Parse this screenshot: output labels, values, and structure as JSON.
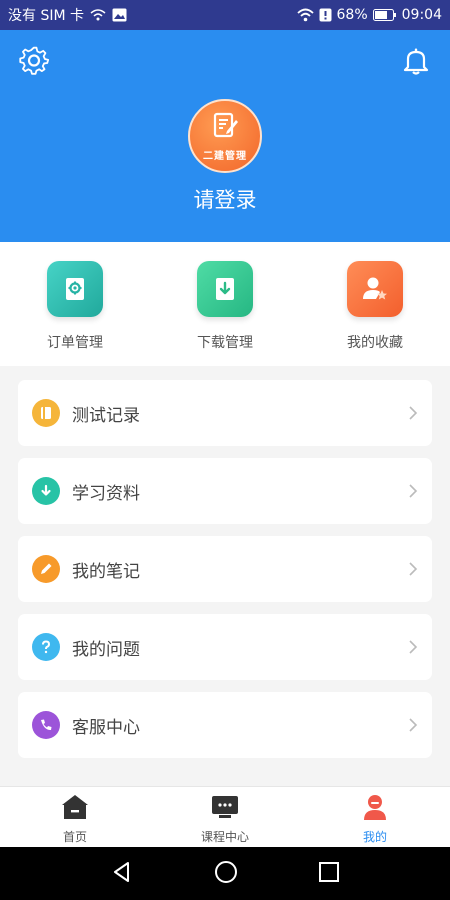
{
  "status_bar": {
    "carrier": "没有 SIM 卡",
    "battery": "68%",
    "time": "09:04"
  },
  "header": {
    "avatar_logo_text": "二建管理",
    "login_text": "请登录",
    "bg_color": "#2a8df0"
  },
  "quick_actions": [
    {
      "label": "订单管理",
      "icon": "order-icon"
    },
    {
      "label": "下载管理",
      "icon": "download-icon"
    },
    {
      "label": "我的收藏",
      "icon": "favorite-user-icon"
    }
  ],
  "menu": [
    {
      "label": "测试记录",
      "icon": "notebook-icon",
      "color": "#f5b53a"
    },
    {
      "label": "学习资料",
      "icon": "download-circle-icon",
      "color": "#27c3a6"
    },
    {
      "label": "我的笔记",
      "icon": "pencil-icon",
      "color": "#f79a2a"
    },
    {
      "label": "我的问题",
      "icon": "question-icon",
      "color": "#3fb8ef"
    },
    {
      "label": "客服中心",
      "icon": "phone-icon",
      "color": "#9c54d9"
    }
  ],
  "tabbar": {
    "items": [
      {
        "label": "首页",
        "icon": "home-icon"
      },
      {
        "label": "课程中心",
        "icon": "course-icon"
      },
      {
        "label": "我的",
        "icon": "profile-icon"
      }
    ],
    "active_index": 2,
    "active_color": "#2a8df0"
  }
}
